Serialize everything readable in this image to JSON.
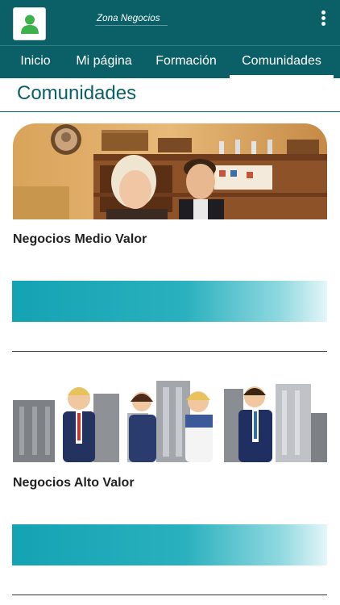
{
  "header": {
    "brand": "Zona Negocios",
    "avatar_icon": "user-icon",
    "menu_icon": "kebab-menu-icon",
    "theme_color": "#0b5f67"
  },
  "nav": {
    "tabs": [
      {
        "label": "Inicio",
        "active": false
      },
      {
        "label": "Mi página",
        "active": false
      },
      {
        "label": "Formación",
        "active": false
      },
      {
        "label": "Comunidades",
        "active": true
      }
    ]
  },
  "page": {
    "title": "Comunidades"
  },
  "communities": [
    {
      "name": "Negocios Medio Valor",
      "image": "shop-owners-photo"
    },
    {
      "name": "Negocios Alto Valor",
      "image": "business-people-illustration"
    }
  ]
}
